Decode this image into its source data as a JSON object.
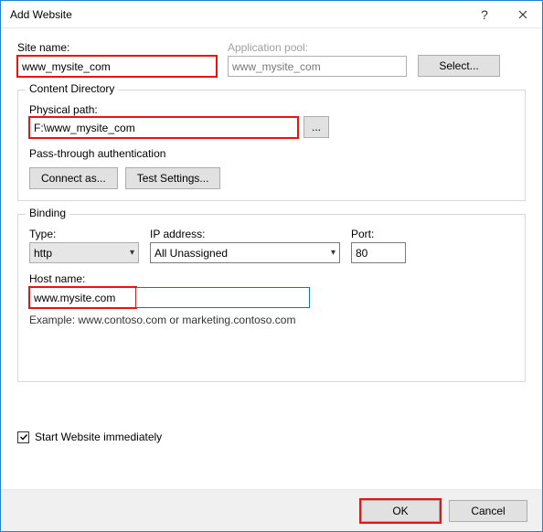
{
  "title": "Add Website",
  "siteName": {
    "label": "Site name:",
    "value": "www_mysite_com"
  },
  "appPool": {
    "label": "Application pool:",
    "value": "www_mysite_com",
    "selectBtn": "Select..."
  },
  "contentDir": {
    "legend": "Content Directory",
    "pathLabel": "Physical path:",
    "pathValue": "F:\\www_mysite_com",
    "passThrough": "Pass-through authentication",
    "connectAs": "Connect as...",
    "testSettings": "Test Settings..."
  },
  "binding": {
    "legend": "Binding",
    "typeLabel": "Type:",
    "typeValue": "http",
    "ipLabel": "IP address:",
    "ipValue": "All Unassigned",
    "portLabel": "Port:",
    "portValue": "80",
    "hostLabel": "Host name:",
    "hostValue": "www.mysite.com",
    "example": "Example: www.contoso.com or marketing.contoso.com"
  },
  "startImmediately": "Start Website immediately",
  "ok": "OK",
  "cancel": "Cancel"
}
